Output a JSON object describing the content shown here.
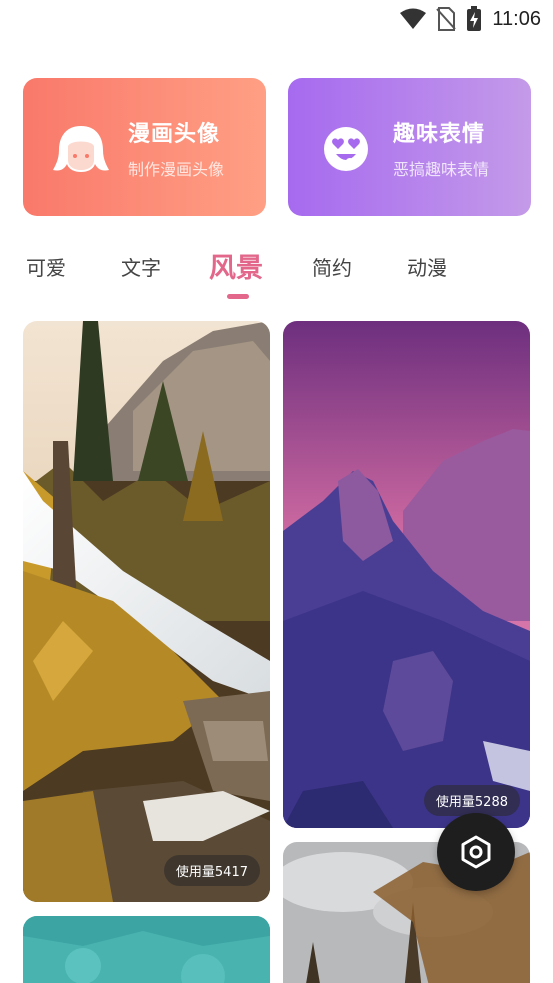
{
  "status_bar": {
    "time": "11:06",
    "icons": [
      "wifi-icon",
      "no-sim-icon",
      "battery-charging-icon"
    ]
  },
  "features": [
    {
      "title": "漫画头像",
      "subtitle": "制作漫画头像",
      "icon": "cartoon-girl-icon",
      "gradient": [
        "#f9796a",
        "#ff9f84"
      ]
    },
    {
      "title": "趣味表情",
      "subtitle": "恶搞趣味表情",
      "icon": "heart-eyes-face-icon",
      "gradient": [
        "#a66aef",
        "#c49ae9"
      ]
    }
  ],
  "tabs": [
    {
      "label": "可爱",
      "active": false
    },
    {
      "label": "文字",
      "active": false
    },
    {
      "label": "风景",
      "active": true
    },
    {
      "label": "简约",
      "active": false
    },
    {
      "label": "动漫",
      "active": false
    }
  ],
  "colors": {
    "accent": "#e2678a",
    "fab": "#1e1e1e"
  },
  "wallpapers": [
    {
      "subject": "forest waterfall",
      "usage": "使用量5417"
    },
    {
      "subject": "purple mountains",
      "usage": "使用量5288"
    },
    {
      "subject": "turquoise water"
    },
    {
      "subject": "cloudy sky with trees"
    }
  ],
  "fab": {
    "icon": "hexagon-settings-icon"
  }
}
